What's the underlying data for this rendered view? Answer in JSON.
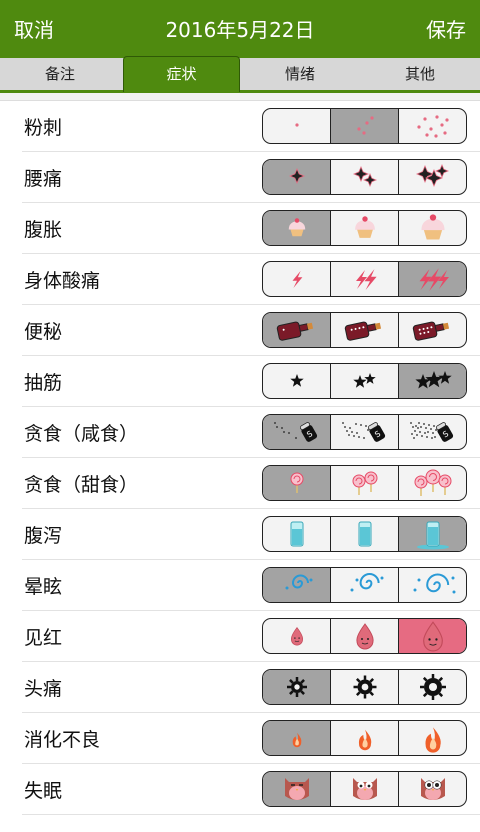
{
  "nav": {
    "cancel": "取消",
    "title": "2016年5月22日",
    "save": "保存"
  },
  "tabs": [
    {
      "label": "备注",
      "active": false
    },
    {
      "label": "症状",
      "active": true
    },
    {
      "label": "情绪",
      "active": false
    },
    {
      "label": "其他",
      "active": false
    }
  ],
  "symptoms": [
    {
      "label": "粉刺",
      "icon": "acne-icon",
      "selected": 1
    },
    {
      "label": "腰痛",
      "icon": "backache-sparkle-icon",
      "selected": 0
    },
    {
      "label": "腹胀",
      "icon": "cupcake-icon",
      "selected": 0
    },
    {
      "label": "身体酸痛",
      "icon": "lightning-icon",
      "selected": 2
    },
    {
      "label": "便秘",
      "icon": "bottle-icon",
      "selected": 0
    },
    {
      "label": "抽筋",
      "icon": "star-icon",
      "selected": 2
    },
    {
      "label": "贪食（咸食）",
      "icon": "salt-shaker-icon",
      "selected": 0
    },
    {
      "label": "贪食（甜食）",
      "icon": "lollipop-icon",
      "selected": 0
    },
    {
      "label": "腹泻",
      "icon": "water-glass-icon",
      "selected": 2
    },
    {
      "label": "晕眩",
      "icon": "swirl-icon",
      "selected": 0
    },
    {
      "label": "见红",
      "icon": "blood-drop-icon",
      "selected": 2
    },
    {
      "label": "头痛",
      "icon": "gear-burst-icon",
      "selected": 0
    },
    {
      "label": "消化不良",
      "icon": "flame-icon",
      "selected": 0
    },
    {
      "label": "失眠",
      "icon": "owl-icon",
      "selected": 0
    }
  ],
  "colors": {
    "brand_green": "#4f8a0f",
    "selected_gray": "#a3a3a3",
    "selected_pink": "#e66b82"
  }
}
